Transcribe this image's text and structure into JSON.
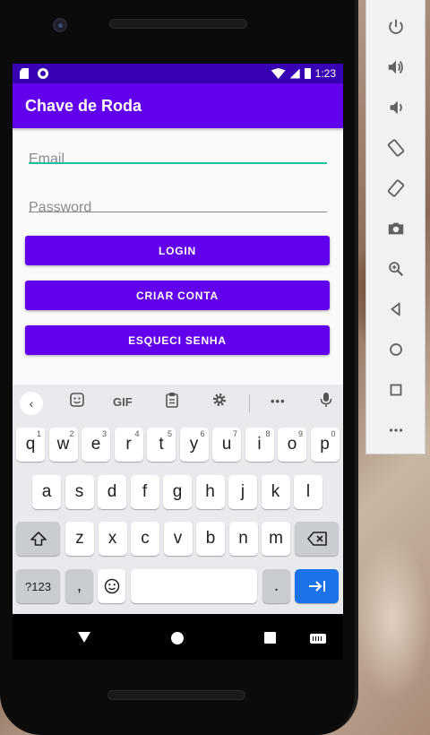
{
  "status_bar": {
    "time": "1:23"
  },
  "app": {
    "title": "Chave de Roda"
  },
  "form": {
    "email_placeholder": "Email",
    "password_placeholder": "Password",
    "login_label": "LOGIN",
    "create_account_label": "CRIAR CONTA",
    "forgot_password_label": "ESQUECI SENHA"
  },
  "keyboard": {
    "toolbar": {
      "gif_label": "GIF",
      "more_label": "•••"
    },
    "row1": [
      {
        "k": "q",
        "h": "1"
      },
      {
        "k": "w",
        "h": "2"
      },
      {
        "k": "e",
        "h": "3"
      },
      {
        "k": "r",
        "h": "4"
      },
      {
        "k": "t",
        "h": "5"
      },
      {
        "k": "y",
        "h": "6"
      },
      {
        "k": "u",
        "h": "7"
      },
      {
        "k": "i",
        "h": "8"
      },
      {
        "k": "o",
        "h": "9"
      },
      {
        "k": "p",
        "h": "0"
      }
    ],
    "row2": [
      "a",
      "s",
      "d",
      "f",
      "g",
      "h",
      "j",
      "k",
      "l"
    ],
    "row3": [
      "z",
      "x",
      "c",
      "v",
      "b",
      "n",
      "m"
    ],
    "symbols_label": "?123",
    "comma_label": ",",
    "period_label": "."
  },
  "colors": {
    "primary": "#6200ee",
    "primary_dark": "#3700b3",
    "accent_focus": "#1fbfa8",
    "enter_key": "#1a73e8"
  },
  "emulator_controls": [
    "power-icon",
    "volume-up-icon",
    "volume-down-icon",
    "rotate-left-icon",
    "rotate-right-icon",
    "camera-icon",
    "zoom-icon",
    "back-icon",
    "home-icon",
    "overview-icon",
    "more-icon"
  ]
}
